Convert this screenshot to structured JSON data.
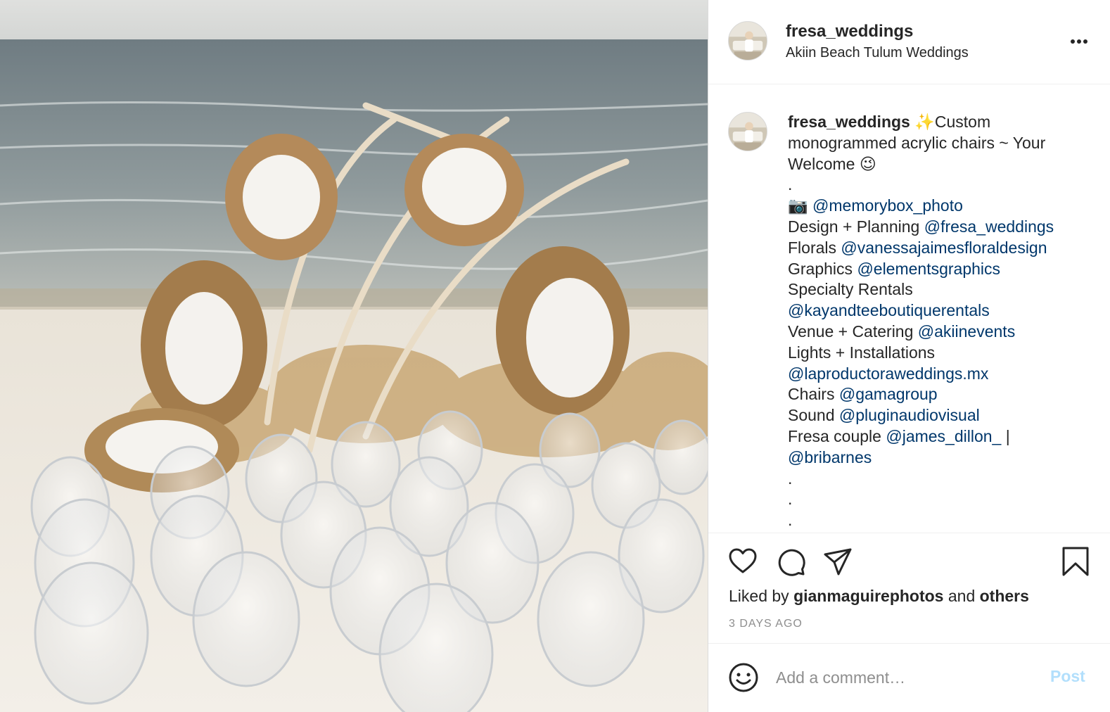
{
  "post": {
    "image_alt": "Beach wedding arch with pampas grass and white flowers behind rows of clear acrylic chairs",
    "header": {
      "username": "fresa_weddings",
      "location": "Akiin Beach Tulum Weddings",
      "more_icon": "more-horizontal-icon"
    },
    "caption": {
      "username": "fresa_weddings",
      "lines": [
        {
          "text": "✨Custom"
        },
        {
          "text": "monogrammed acrylic chairs ~ Your"
        },
        {
          "text": "Welcome 😉"
        },
        {
          "text": "."
        },
        {
          "text": "📷 ",
          "mention": "@memorybox_photo"
        },
        {
          "text": "Design + Planning ",
          "mention": "@fresa_weddings"
        },
        {
          "text": "Florals ",
          "mention": "@vanessajaimesfloraldesign"
        },
        {
          "text": "Graphics ",
          "mention": "@elementsgraphics"
        },
        {
          "text": "Specialty Rentals"
        },
        {
          "text": "",
          "mention": "@kayandteeboutiquerentals"
        },
        {
          "text": "Venue + Catering ",
          "mention": "@akiinevents"
        },
        {
          "text": "Lights + Installations"
        },
        {
          "text": "",
          "mention": "@laproductoraweddings.mx"
        },
        {
          "text": "Chairs ",
          "mention": "@gamagroup"
        },
        {
          "text": "Sound ",
          "mention": "@pluginaudiovisual"
        },
        {
          "text": "Fresa couple ",
          "mention": "@james_dillon_",
          "after": " |"
        },
        {
          "text": "",
          "mention": "@bribarnes"
        },
        {
          "text": "."
        },
        {
          "text": "."
        },
        {
          "text": "."
        }
      ]
    },
    "actions": {
      "like_icon": "heart-icon",
      "comment_icon": "comment-icon",
      "share_icon": "share-icon",
      "save_icon": "bookmark-icon"
    },
    "likes": {
      "prefix": "Liked by ",
      "user": "gianmaguirephotos",
      "middle": " and ",
      "others": "others"
    },
    "timestamp": "3 DAYS AGO",
    "add_comment": {
      "emoji_icon": "smiley-icon",
      "placeholder": "Add a comment…",
      "post_label": "Post"
    },
    "colors": {
      "mention": "#00376b",
      "muted": "#8e8e8e",
      "post_disabled": "#b2dffc",
      "border": "#dbdbdb"
    }
  }
}
